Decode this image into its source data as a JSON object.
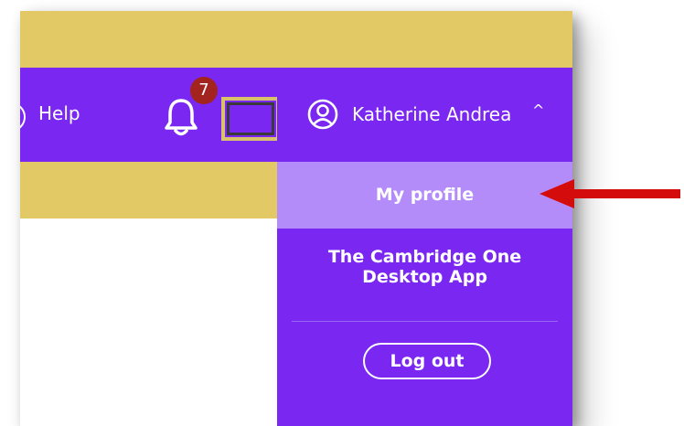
{
  "header": {
    "help_label": "Help",
    "notification_count": "7"
  },
  "user_menu": {
    "user_name": "Katherine Andrea",
    "caret": "^",
    "items": [
      {
        "label": "My profile",
        "highlighted": true
      },
      {
        "label_line1": "The Cambridge One",
        "label_line2": "Desktop App"
      }
    ],
    "logout_label": "Log out"
  },
  "colors": {
    "header_purple": "#7a27f2",
    "highlight_lavender": "#b38cfa",
    "gold_band": "#e2c965",
    "badge_red": "#a3241f",
    "annotation_arrow": "#d40c0c"
  },
  "icons": {
    "help": "help-icon",
    "notifications": "bell-icon",
    "user": "user-circle-icon",
    "annotation": "red-arrow-icon"
  }
}
